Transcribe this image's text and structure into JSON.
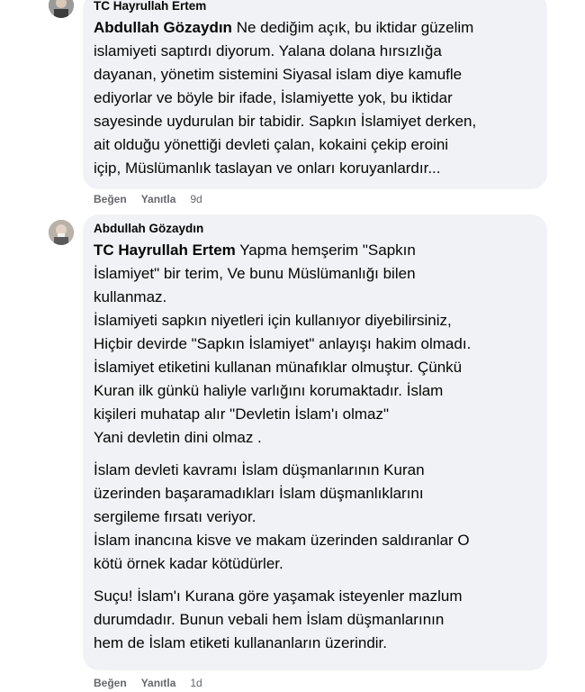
{
  "comments": [
    {
      "author": "TC Hayrullah Ertem",
      "mention": "Abdullah Gözaydın",
      "lead": "Ne dediğim açık, bu iktidar güzelim",
      "lines": [
        "islamiyeti saptırdı diyorum. Yalana dolana hırsızlığa",
        "dayanan, yönetim sistemini Siyasal islam diye kamufle",
        "ediyorlar ve böyle bir ifade, İslamiyette yok, bu iktidar",
        "sayesinde uydurulan bir tabidir. Sapkın İslamiyet derken,",
        "ait olduğu yönettiği devleti çalan, kokaini çekip eroini",
        "içip, Müslümanlık taslayan ve onları koruyanlardır..."
      ],
      "like": "Beğen",
      "reply": "Yanıtla",
      "time": "9d"
    },
    {
      "author": "Abdullah Gözaydın",
      "mention": "TC Hayrullah Ertem",
      "lead": "Yapma hemşerim \"Sapkın",
      "block1": [
        "İslamiyet\" bir terim, Ve bunu Müslümanlığı bilen",
        "kullanmaz.",
        "İslamiyeti sapkın niyetleri için kullanıyor diyebilirsiniz,",
        "Hiçbir devirde \"Sapkın İslamiyet\" anlayışı hakim olmadı.",
        "İslamiyet etiketini kullanan münafıklar olmuştur. Çünkü",
        "Kuran ilk günkü haliyle varlığını korumaktadır. İslam",
        "kişileri muhatap alır \"Devletin İslam'ı olmaz\"",
        "Yani devletin dini olmaz ."
      ],
      "block2": [
        "İslam devleti kavramı İslam düşmanlarının Kuran",
        "üzerinden başaramadıkları İslam düşmanlıklarını",
        "sergileme fırsatı veriyor.",
        "İslam inancına kisve ve makam üzerinden saldıranlar O",
        "kötü örnek kadar kötüdürler."
      ],
      "block3": [
        "Suçu! İslam'ı Kurana göre yaşamak isteyenler mazlum",
        "durumdadır. Bunun vebali hem İslam düşmanlarının",
        "hem de İslam etiketi kullananların üzerindir."
      ],
      "like": "Beğen",
      "reply": "Yanıtla",
      "time": "1d"
    }
  ]
}
